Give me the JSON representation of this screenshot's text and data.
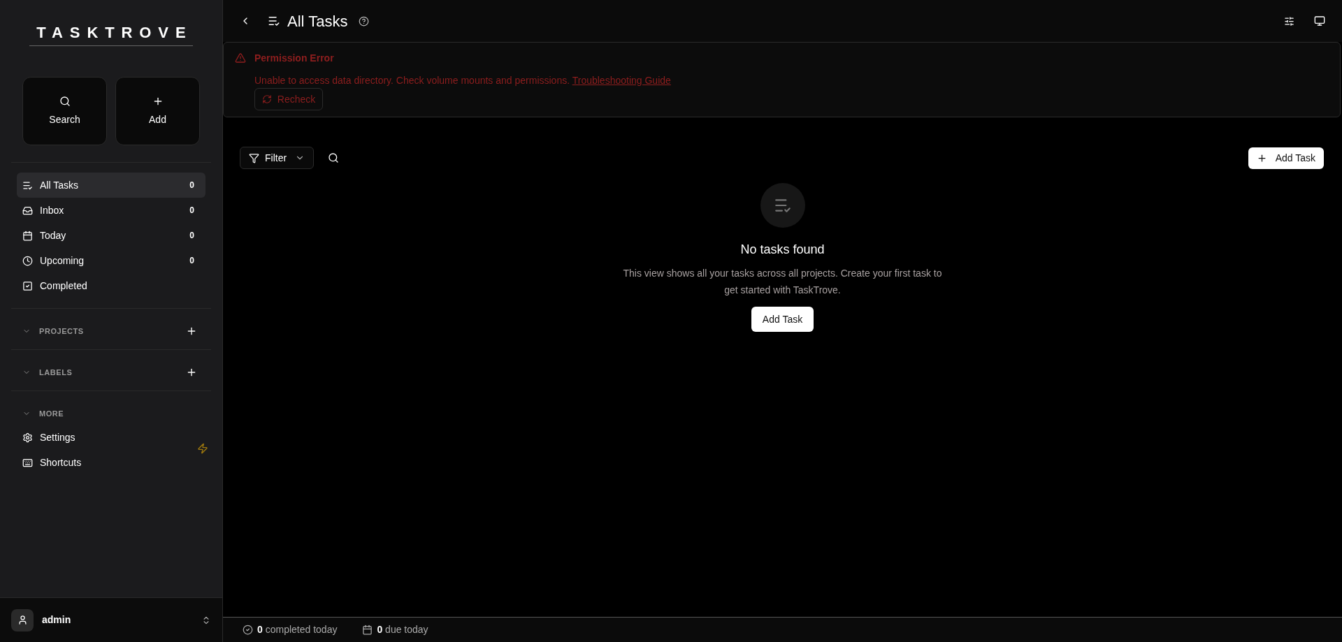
{
  "sidebar": {
    "logo": "TASKTROVE",
    "quick_actions": [
      {
        "label": "Search"
      },
      {
        "label": "Add"
      }
    ],
    "nav": [
      {
        "label": "All Tasks",
        "count": "0",
        "selected": true
      },
      {
        "label": "Inbox",
        "count": "0",
        "selected": false
      },
      {
        "label": "Today",
        "count": "0",
        "selected": false
      },
      {
        "label": "Upcoming",
        "count": "0",
        "selected": false
      },
      {
        "label": "Completed",
        "selected": false
      }
    ],
    "sections": [
      {
        "title": "PROJECTS",
        "expanded": true,
        "add": true
      },
      {
        "title": "LABELS",
        "expanded": true,
        "add": true
      },
      {
        "title": "MORE",
        "expanded": true,
        "add": false,
        "items": [
          {
            "label": "Settings"
          },
          {
            "label": "Shortcuts"
          }
        ]
      }
    ],
    "user": {
      "name": "admin"
    }
  },
  "header": {
    "title": "All Tasks"
  },
  "error": {
    "title": "Permission Error",
    "message": "Unable to access data directory. Check volume mounts and permissions.",
    "link": "Troubleshooting Guide",
    "button": "Recheck"
  },
  "toolbar": {
    "filter": "Filter",
    "add_button": "Add Task"
  },
  "empty_state": {
    "title": "No tasks found",
    "description": "This view shows all your tasks across all projects. Create your first task to get started with TaskTrove.",
    "button": "Add Task"
  },
  "status_bar": [
    {
      "text": "**0** completed today"
    },
    {
      "text": "**0** due today"
    }
  ]
}
